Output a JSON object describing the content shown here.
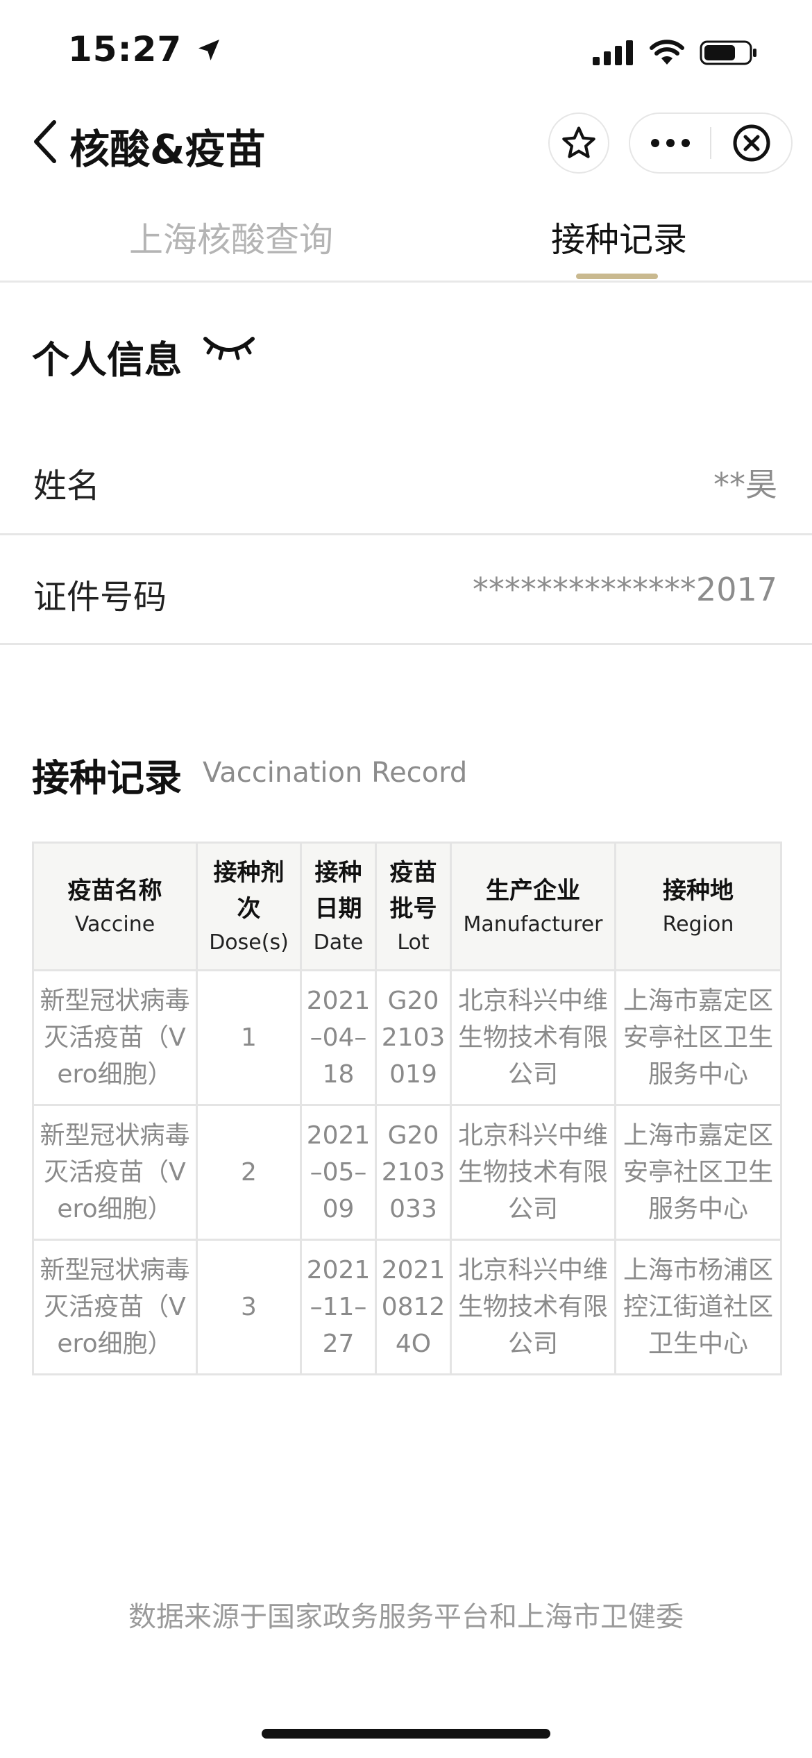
{
  "status_bar": {
    "time": "15:27"
  },
  "nav": {
    "title": "核酸&疫苗"
  },
  "tabs": [
    {
      "label": "上海核酸查询"
    },
    {
      "label": "接种记录"
    }
  ],
  "personal_info": {
    "title": "个人信息",
    "rows": [
      {
        "label": "姓名",
        "value": "**昊"
      },
      {
        "label": "证件号码",
        "value": "**************2017"
      }
    ]
  },
  "vaccination_record": {
    "title": "接种记录",
    "subtitle": "Vaccination Record",
    "columns": [
      {
        "cn": "疫苗名称",
        "en": "Vaccine"
      },
      {
        "cn": "接种剂次",
        "en": "Dose(s)"
      },
      {
        "cn": "接种日期",
        "en": "Date"
      },
      {
        "cn": "疫苗批号",
        "en": "Lot"
      },
      {
        "cn": "生产企业",
        "en": "Manufacturer"
      },
      {
        "cn": "接种地",
        "en": "Region"
      }
    ],
    "rows": [
      [
        "新型冠状病毒灭活疫苗（Vero细胞）",
        "1",
        "2021–04–18",
        "G202103019",
        "北京科兴中维生物技术有限公司",
        "上海市嘉定区安亭社区卫生服务中心"
      ],
      [
        "新型冠状病毒灭活疫苗（Vero细胞）",
        "2",
        "2021–05–09",
        "G202103033",
        "北京科兴中维生物技术有限公司",
        "上海市嘉定区安亭社区卫生服务中心"
      ],
      [
        "新型冠状病毒灭活疫苗（Vero细胞）",
        "3",
        "2021–11–27",
        "20210812 4O",
        "北京科兴中维生物技术有限公司",
        "上海市杨浦区控江街道社区卫生中心"
      ]
    ]
  },
  "footer": {
    "text": "数据来源于国家政务服务平台和上海市卫健委"
  }
}
